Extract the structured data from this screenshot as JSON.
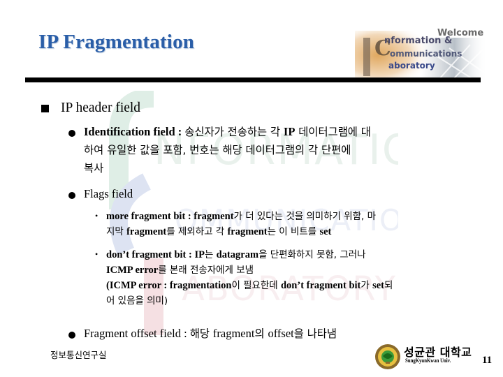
{
  "slide": {
    "title": "IP Fragmentation",
    "banner": {
      "welcome": "Welcome",
      "line1": "nformation &",
      "line2": "ommunications",
      "line3": "aboratory",
      "initials": [
        "I",
        "C",
        "L"
      ]
    },
    "watermark_text": [
      "INFORMATION",
      "COMMUNICATIONS",
      "LABORATORY"
    ],
    "colors": {
      "title": "#2a5ea8",
      "rule": "#000000"
    },
    "content": {
      "heading": "IP header field",
      "items": [
        {
          "term": "Identification field :",
          "lines": [
            {
              "ko": "송신자가 전송하는 각 ",
              "en": "IP",
              "ko2": " 데이터그램에 대"
            },
            {
              "ko": "하여 유일한 값을 포함, 번호는 해당 데이터그램의 각 단편에"
            },
            {
              "ko": "복사"
            }
          ]
        },
        {
          "term": "Flags field",
          "subitems": [
            {
              "term": "more fragment bit : fragment",
              "line1_ko": "가 더 있다는 것을 의미하기 위함, 마",
              "line2_ko_a": "지막 ",
              "line2_en_a": "fragment",
              "line2_ko_b": "를 제외하고 각 ",
              "line2_en_b": "fragment",
              "line2_ko_c": "는 이 비트를 ",
              "line2_en_c": "set"
            },
            {
              "term": "don’t fragment bit : IP",
              "line1_ko_a": "는 ",
              "line1_en_a": "datagram",
              "line1_ko_b": "을 단편화하지 못함, 그러나",
              "line2_en": "ICMP error",
              "line2_ko": "를 본래 전송자에게 보냄",
              "line3_en_a": "(ICMP error : fragmentation",
              "line3_ko_a": "이 필요한데 ",
              "line3_en_b": "don’t fragment bit",
              "line3_ko_b": "가 ",
              "line3_en_c": "set",
              "line3_ko_c": "되",
              "line4_ko": "어 있음을 의미)"
            }
          ]
        },
        {
          "term": "Fragment offset field : ",
          "ko_a": "해당 ",
          "en_a": "fragment",
          "ko_b": "의 ",
          "en_b": "offset",
          "ko_c": "을 나타냄"
        }
      ]
    },
    "footer": {
      "lab_name": "정보통신연구실",
      "university": "성균관 대학교",
      "university_en": "SungKyunKwan Univ.",
      "page_number": "11"
    }
  }
}
